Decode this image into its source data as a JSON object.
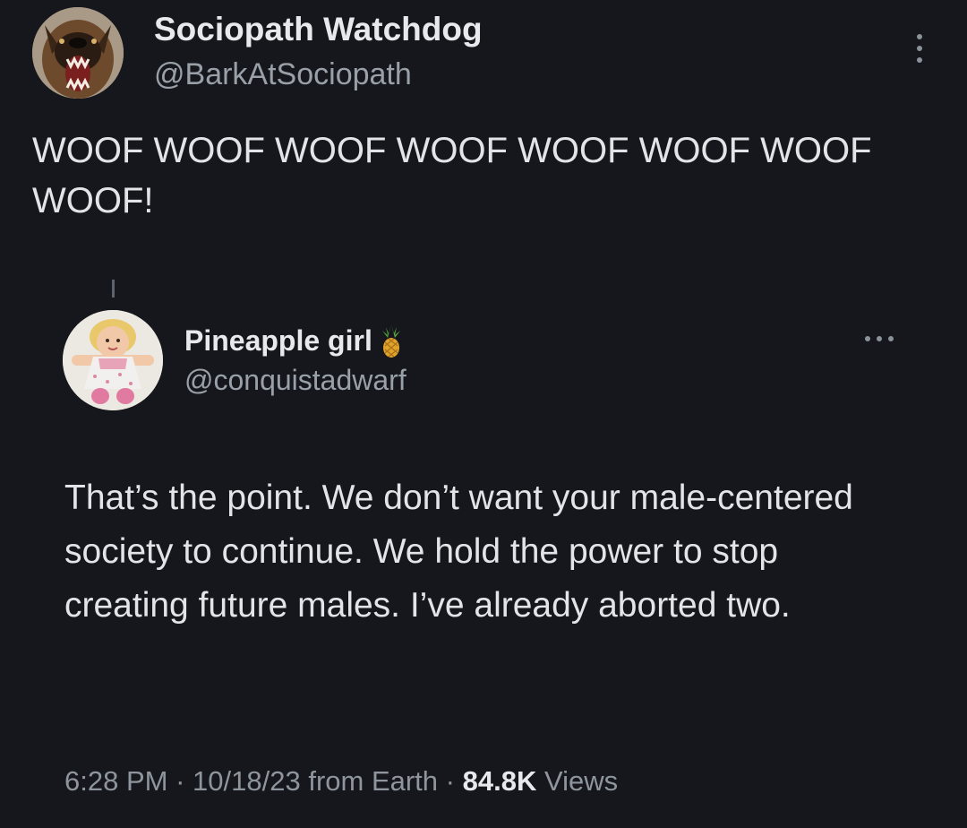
{
  "tweet": {
    "author": {
      "display_name": "Sociopath Watchdog",
      "handle": "@BarkAtSociopath",
      "avatar_icon": "barking-dog-avatar"
    },
    "text": "WOOF WOOF WOOF WOOF WOOF WOOF WOOF WOOF!",
    "menu_icon": "more-vertical-icon"
  },
  "reply": {
    "author": {
      "display_name": "Pineapple girl",
      "name_emoji": "pineapple-emoji",
      "handle": "@conquistadwarf",
      "avatar_icon": "doll-avatar"
    },
    "text": "That’s the point. We don’t want your male-centered society to continue. We hold the power to stop creating future males. I’ve already aborted two.",
    "menu_icon": "more-horizontal-icon",
    "meta": {
      "time": "6:28 PM",
      "date": "10/18/23",
      "source": "from Earth",
      "separator": "·",
      "views_count": "84.8K",
      "views_label": "Views"
    }
  },
  "colors": {
    "background": "#15171c",
    "primary_text": "#e4e6ea",
    "secondary_text": "#9aa0a8"
  }
}
